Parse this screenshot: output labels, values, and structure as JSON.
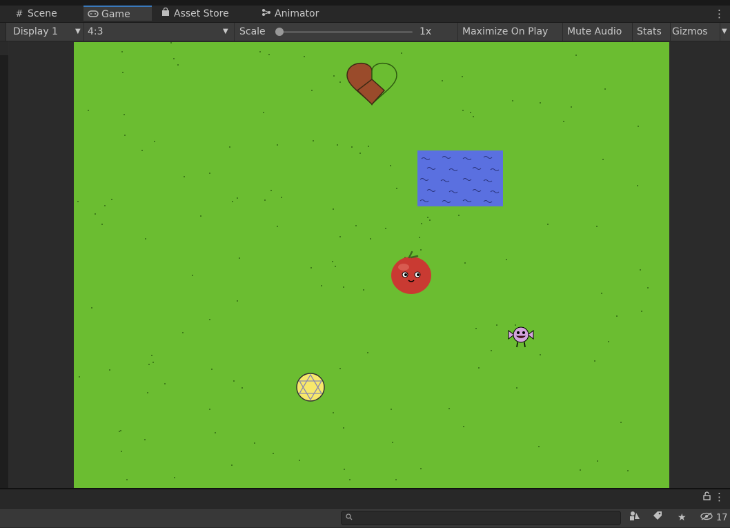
{
  "tabs": [
    {
      "label": "Scene",
      "icon": "grid-icon"
    },
    {
      "label": "Game",
      "icon": "gamepad-icon",
      "active": true
    },
    {
      "label": "Asset Store",
      "icon": "bag-icon"
    },
    {
      "label": "Animator",
      "icon": "animator-icon"
    }
  ],
  "toolbar": {
    "display": "Display 1",
    "aspect": "4:3",
    "scale_label": "Scale",
    "scale_value": "1x",
    "maximize": "Maximize On Play",
    "mute": "Mute Audio",
    "stats": "Stats",
    "gizmos": "Gizmos"
  },
  "bottom": {
    "search_placeholder": "",
    "hidden_count": "17"
  },
  "colors": {
    "grass": "#6bbd31",
    "water": "#5a70e0",
    "tomato": "#c93a32",
    "heart_brown": "#9a4b2b",
    "pentacle_yellow": "#f7e86b"
  }
}
